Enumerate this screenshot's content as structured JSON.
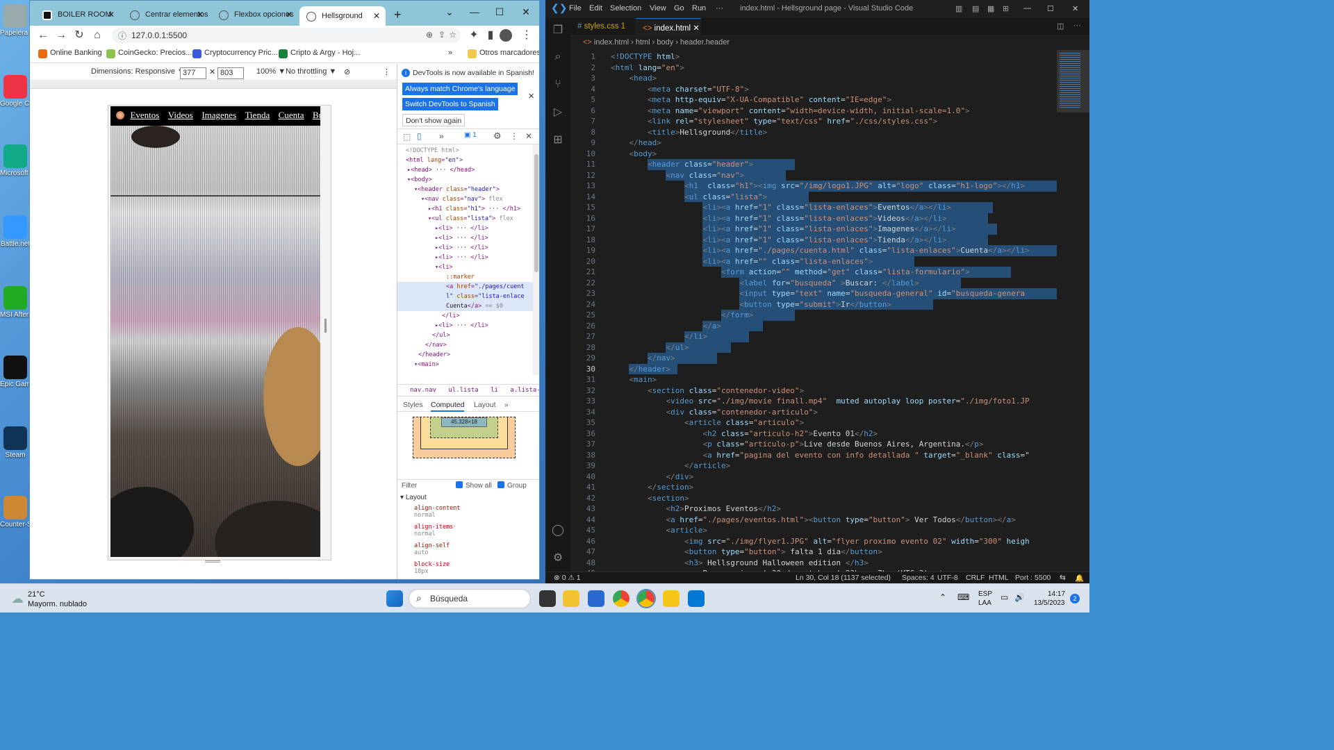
{
  "desktop": {
    "icons": [
      {
        "label": "Papelera reciclaje"
      },
      {
        "label": "Google Chrome"
      },
      {
        "label": "Microsoft Edge"
      },
      {
        "label": "Battle.net"
      },
      {
        "label": "MSI Afterburner"
      },
      {
        "label": "Epic Games Launcher"
      },
      {
        "label": "Steam"
      },
      {
        "label": "Counter-Strike Global Offensive"
      }
    ]
  },
  "chrome": {
    "tabs": [
      {
        "label": "BOILER ROOM",
        "icon": "boiler-room-icon"
      },
      {
        "label": "Centrar elementos",
        "icon": "globe-icon"
      },
      {
        "label": "Flexbox opciones",
        "icon": "globe-icon"
      },
      {
        "label": "Hellsground",
        "icon": "globe-icon",
        "active": true
      }
    ],
    "new_tab": "+",
    "url": "127.0.0.1:5500",
    "bookmarks": [
      {
        "label": "Online Banking",
        "color": "#ec6b12"
      },
      {
        "label": "CoinGecko: Precios...",
        "color": "#8bc34a"
      },
      {
        "label": "Cryptocurrency Pric...",
        "color": "#3b5bdb"
      },
      {
        "label": "Cripto & Argy - Hoj...",
        "color": "#188038"
      }
    ],
    "bookmarks_more": "»",
    "other_bookmarks": "Otros marcadores",
    "device_toolbar": {
      "dimensions": "Dimensions: Responsive ▼",
      "width": "377",
      "times": "✕",
      "height": "803",
      "zoom": "100% ▼",
      "throttle": "No throttling ▼"
    },
    "page": {
      "nav_links": [
        "Eventos",
        "Videos",
        "Imagenes",
        "Tienda",
        "Cuenta",
        "Buscar"
      ]
    },
    "devtools": {
      "banner_text": "DevTools is now available in Spanish!",
      "btn_match": "Always match Chrome's language",
      "btn_switch": "Switch DevTools to Spanish",
      "btn_dont": "Don't show again",
      "badge": "1",
      "breadcrumbs": [
        "nav.nav",
        "ul.lista",
        "li",
        "a.lista-enlaces"
      ],
      "style_tabs": [
        "Styles",
        "Computed",
        "Layout",
        "»"
      ],
      "box_size": "45.328×18",
      "filter_placeholder": "Filter",
      "show_all": "Show all",
      "group": "Group",
      "layout_title": "Layout",
      "props": [
        {
          "name": "align-content",
          "value": "normal"
        },
        {
          "name": "align-items",
          "value": "normal"
        },
        {
          "name": "align-self",
          "value": "auto"
        },
        {
          "name": "block-size",
          "value": "18px"
        }
      ]
    }
  },
  "vscode": {
    "menu": [
      "File",
      "Edit",
      "Selection",
      "View",
      "Go",
      "Run",
      "···"
    ],
    "title": "index.html - Hellsground page - Visual Studio Code",
    "tabs": [
      {
        "label": "styles.css 1",
        "active": false
      },
      {
        "label": "index.html",
        "active": true
      }
    ],
    "breadcrumbs": [
      "index.html",
      "html",
      "body",
      "header.header"
    ],
    "status": {
      "problems": "⊗ 0 ⚠ 1",
      "position": "Ln 30, Col 18 (1137 selected)",
      "spaces": "Spaces: 4",
      "encoding": "UTF-8",
      "eol": "CRLF",
      "language": "HTML",
      "port": "Port : 5500"
    }
  },
  "taskbar": {
    "weather_temp": "21°C",
    "weather_desc": "Mayorm. nublado",
    "search": "Búsqueda",
    "lang": "ESP",
    "lang2": "LAA",
    "time": "14:17",
    "date": "13/5/2023",
    "notif": "2"
  },
  "colors": {
    "vscode_bg": "#1e1e1e",
    "tag": "#569cd6",
    "attr": "#9cdcfe",
    "string": "#ce9178",
    "selection": "#264f78",
    "chrome_tabbar": "#8fc5d8",
    "devtools_blue": "#1a73e8"
  }
}
